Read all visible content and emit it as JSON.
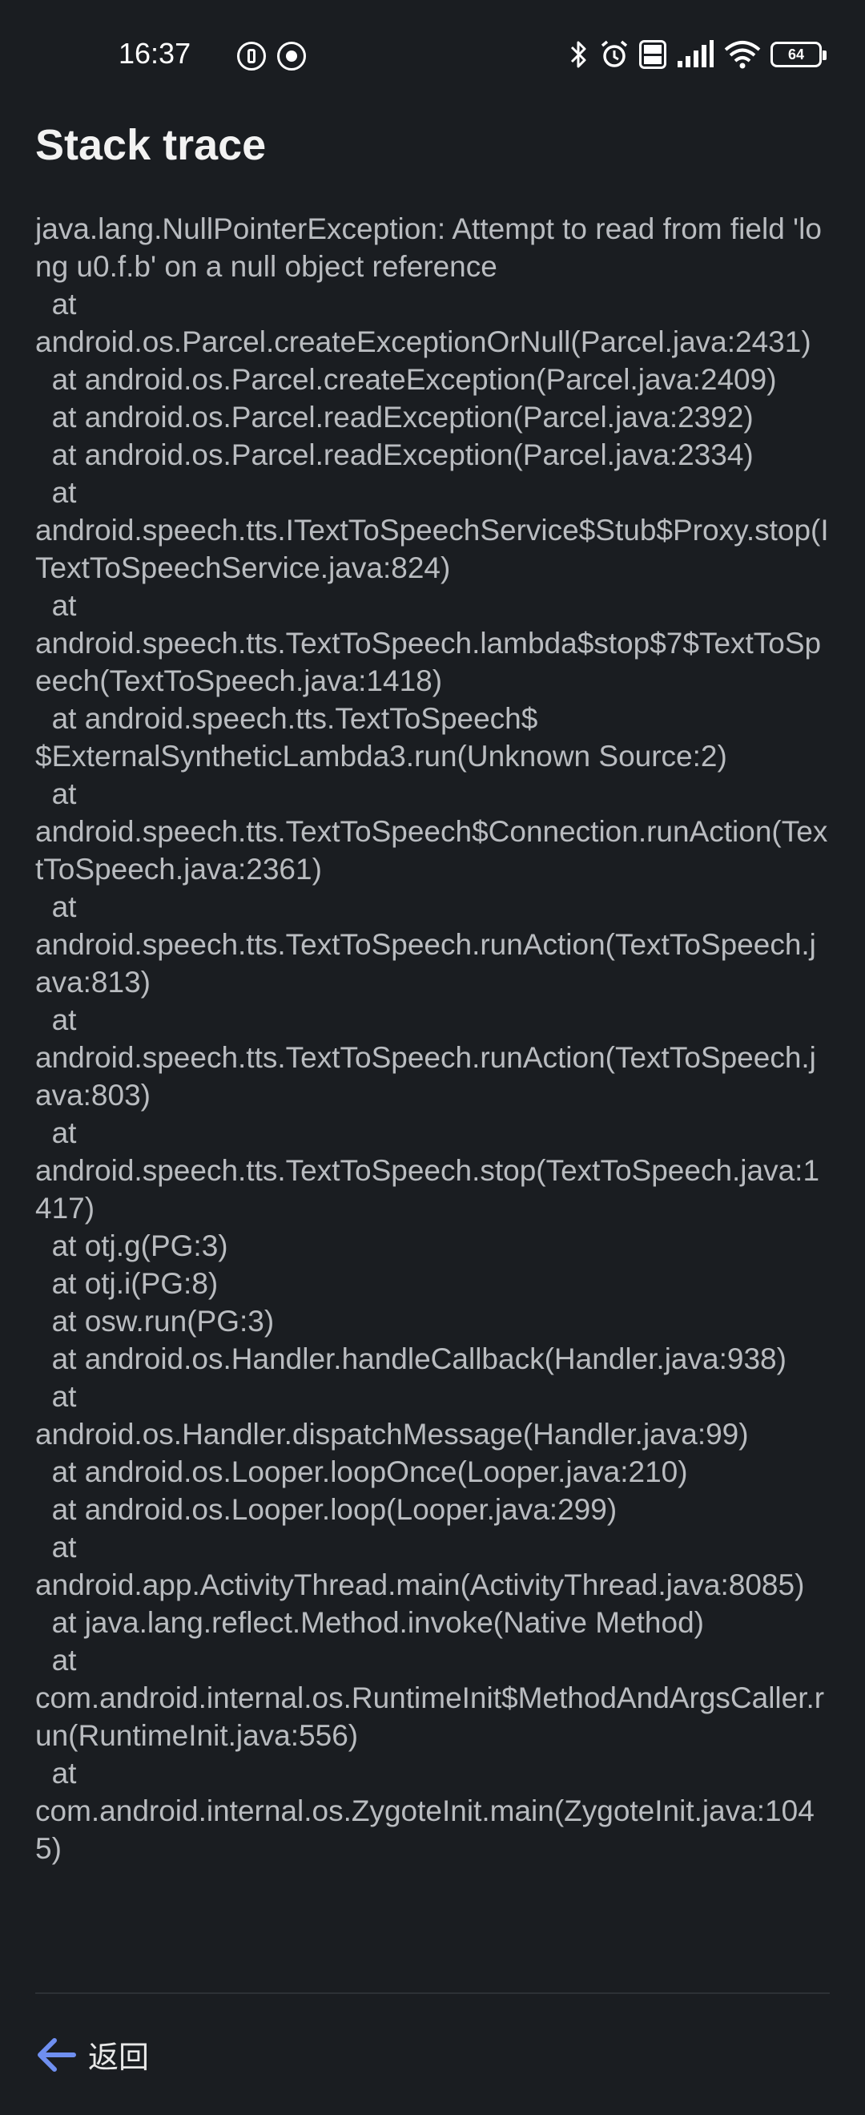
{
  "status_bar": {
    "time": "16:37",
    "battery": "64"
  },
  "page": {
    "title": "Stack trace"
  },
  "trace_lines": [
    "java.lang.NullPointerException: Attempt to read from field 'long u0.f.b' on a null object reference",
    "  at",
    "android.os.Parcel.createExceptionOrNull(Parcel.java:2431)",
    "  at android.os.Parcel.createException(Parcel.java:2409)",
    "  at android.os.Parcel.readException(Parcel.java:2392)",
    "  at android.os.Parcel.readException(Parcel.java:2334)",
    "  at",
    "android.speech.tts.ITextToSpeechService$Stub$Proxy.stop(ITextToSpeechService.java:824)",
    "  at",
    "android.speech.tts.TextToSpeech.lambda$stop$7$TextToSpeech(TextToSpeech.java:1418)",
    "  at android.speech.tts.TextToSpeech$",
    "$ExternalSyntheticLambda3.run(Unknown Source:2)",
    "  at",
    "android.speech.tts.TextToSpeech$Connection.runAction(TextToSpeech.java:2361)",
    "  at",
    "android.speech.tts.TextToSpeech.runAction(TextToSpeech.java:813)",
    "  at",
    "android.speech.tts.TextToSpeech.runAction(TextToSpeech.java:803)",
    "  at",
    "android.speech.tts.TextToSpeech.stop(TextToSpeech.java:1417)",
    "  at otj.g(PG:3)",
    "  at otj.i(PG:8)",
    "  at osw.run(PG:3)",
    "  at android.os.Handler.handleCallback(Handler.java:938)",
    "  at",
    "android.os.Handler.dispatchMessage(Handler.java:99)",
    "  at android.os.Looper.loopOnce(Looper.java:210)",
    "  at android.os.Looper.loop(Looper.java:299)",
    "  at",
    "android.app.ActivityThread.main(ActivityThread.java:8085)",
    "  at java.lang.reflect.Method.invoke(Native Method)",
    "  at",
    "com.android.internal.os.RuntimeInit$MethodAndArgsCaller.run(RuntimeInit.java:556)",
    "  at",
    "com.android.internal.os.ZygoteInit.main(ZygoteInit.java:1045)"
  ],
  "footer": {
    "back_label": "返回"
  },
  "colors": {
    "background": "#1a1d21",
    "trace_text": "#b9bcc0",
    "accent": "#6f8ff0"
  }
}
